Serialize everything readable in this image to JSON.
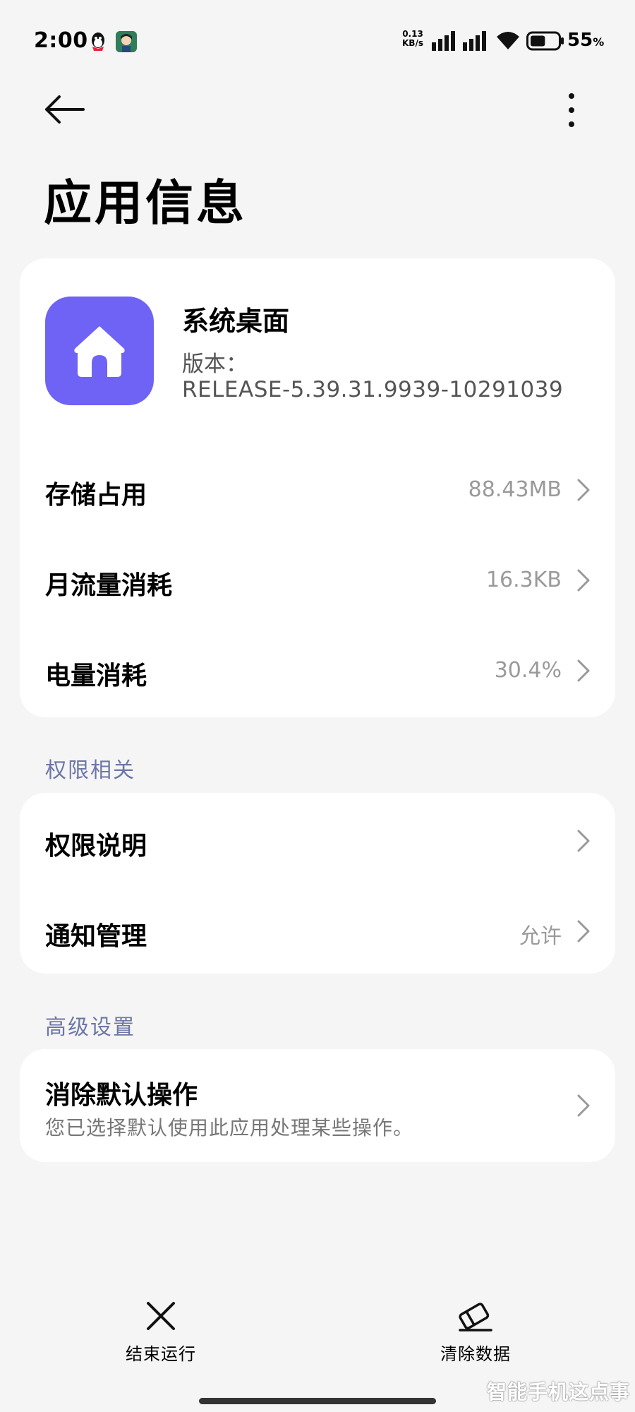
{
  "status_bar": {
    "time": "2:00",
    "net_speed_value": "0.13",
    "net_speed_unit": "KB/s",
    "battery_percent": "55",
    "battery_unit": "%",
    "battery_level": 0.55
  },
  "header": {
    "title": "应用信息"
  },
  "app": {
    "name": "系统桌面",
    "version_label": "版本：",
    "version": "RELEASE-5.39.31.9939-10291039",
    "icon_color": "#6f63f5"
  },
  "info_rows": [
    {
      "label": "存储占用",
      "value": "88.43MB"
    },
    {
      "label": "月流量消耗",
      "value": "16.3KB"
    },
    {
      "label": "电量消耗",
      "value": "30.4%"
    }
  ],
  "permissions": {
    "section_title": "权限相关",
    "rows": [
      {
        "label": "权限说明",
        "value": ""
      },
      {
        "label": "通知管理",
        "value": "允许"
      }
    ]
  },
  "advanced": {
    "section_title": "高级设置",
    "clear_defaults_label": "消除默认操作",
    "clear_defaults_desc": "您已选择默认使用此应用处理某些操作。"
  },
  "bottom_actions": {
    "force_stop": "结束运行",
    "clear_data": "清除数据"
  },
  "watermark": "智能手机这点事"
}
